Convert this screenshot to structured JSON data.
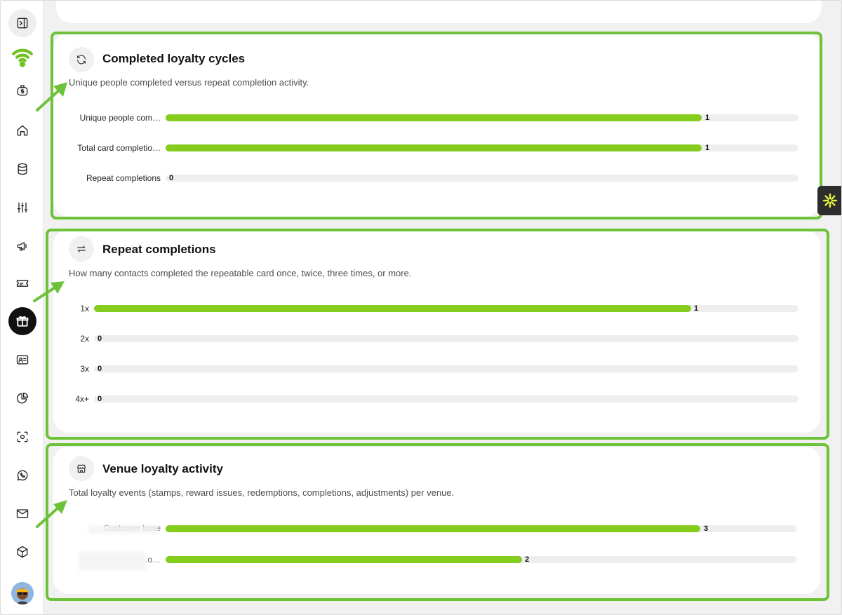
{
  "sidebar": {
    "icons": [
      "panel-toggle-icon",
      "wifi-logo-icon",
      "money-bag-icon",
      "home-icon",
      "database-icon",
      "sliders-icon",
      "megaphone-icon",
      "ticket-icon",
      "gift-icon",
      "id-card-icon",
      "pie-chart-icon",
      "scan-icon",
      "whatsapp-icon",
      "mail-icon",
      "box-icon",
      "avatar"
    ]
  },
  "colors": {
    "accent": "#84cc1e",
    "highlight": "#6ec23a",
    "track": "#eeeeee"
  },
  "cards": [
    {
      "title": "Completed loyalty cycles",
      "description": "Unique people completed versus repeat completion activity.",
      "icon": "refresh-icon",
      "rows": [
        {
          "label": "Unique people com…",
          "value": "1",
          "fraction": 0.85
        },
        {
          "label": "Total card completio…",
          "value": "1",
          "fraction": 0.85
        },
        {
          "label": "Repeat completions",
          "value": "0",
          "fraction": 0
        }
      ]
    },
    {
      "title": "Repeat completions",
      "description": "How many contacts completed the repeatable card once, twice, three times, or more.",
      "icon": "repeat-arrows-icon",
      "rows": [
        {
          "label": "1x",
          "value": "1",
          "fraction": 0.85
        },
        {
          "label": "2x",
          "value": "0",
          "fraction": 0
        },
        {
          "label": "3x",
          "value": "0",
          "fraction": 0
        },
        {
          "label": "4x+",
          "value": "0",
          "fraction": 0
        }
      ]
    },
    {
      "title": "Venue loyalty activity",
      "description": "Total loyalty events (stamps, reward issues, redemptions, completions, adjustments) per venue.",
      "icon": "store-icon",
      "rows": [
        {
          "label": "Customer base",
          "value": "3",
          "fraction": 0.85
        },
        {
          "label": "…o…",
          "value": "2",
          "fraction": 0.57
        }
      ]
    }
  ]
}
